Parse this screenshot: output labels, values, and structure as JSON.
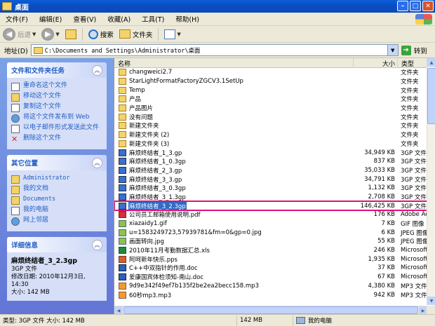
{
  "window": {
    "title": "桌面"
  },
  "menu": [
    "文件(F)",
    "编辑(E)",
    "查看(V)",
    "收藏(A)",
    "工具(T)",
    "帮助(H)"
  ],
  "toolbar": {
    "back": "后退",
    "search": "搜索",
    "folders": "文件夹"
  },
  "address": {
    "label": "地址(D)",
    "path": "C:\\Documents and Settings\\Administrator\\桌面",
    "go": "转到"
  },
  "tasks": {
    "title": "文件和文件夹任务",
    "items": [
      "重命名这个文件",
      "移动这个文件",
      "复制这个文件",
      "将这个文件发布到 Web",
      "以电子邮件形式发送此文件",
      "删除这个文件"
    ]
  },
  "places": {
    "title": "其它位置",
    "items": [
      "Administrator",
      "我的文档",
      "Documents",
      "我的电脑",
      "网上邻居"
    ]
  },
  "details": {
    "title": "详细信息",
    "name": "麻烦终结者_3_2.3gp",
    "type": "3GP 文件",
    "modified_label": "修改日期: 2010年12月3日, 14:30",
    "size": "大小: 142 MB"
  },
  "columns": {
    "name": "名称",
    "size": "大小",
    "type": "类型"
  },
  "files": [
    {
      "name": "changweici2.7",
      "size": "",
      "type": "文件夹",
      "icon": "folder"
    },
    {
      "name": "StarLightFormatFactoryZGCV3.1SetUp",
      "size": "",
      "type": "文件夹",
      "icon": "folder"
    },
    {
      "name": "Temp",
      "size": "",
      "type": "文件夹",
      "icon": "folder"
    },
    {
      "name": "产品",
      "size": "",
      "type": "文件夹",
      "icon": "folder"
    },
    {
      "name": "产品图片",
      "size": "",
      "type": "文件夹",
      "icon": "folder"
    },
    {
      "name": "没有问题",
      "size": "",
      "type": "文件夹",
      "icon": "folder"
    },
    {
      "name": "新建文件夹",
      "size": "",
      "type": "文件夹",
      "icon": "folder"
    },
    {
      "name": "新建文件夹 (2)",
      "size": "",
      "type": "文件夹",
      "icon": "folder"
    },
    {
      "name": "新建文件夹 (3)",
      "size": "",
      "type": "文件夹",
      "icon": "folder"
    },
    {
      "name": "麻烦终结者_1_3.gp",
      "size": "34,949 KB",
      "type": "3GP 文件",
      "icon": "gp"
    },
    {
      "name": "麻烦终结者_1_0.3gp",
      "size": "837 KB",
      "type": "3GP 文件",
      "icon": "gp"
    },
    {
      "name": "麻烦终结者_2_3.gp",
      "size": "35,033 KB",
      "type": "3GP 文件",
      "icon": "gp"
    },
    {
      "name": "麻烦终结者_3_3.gp",
      "size": "34,791 KB",
      "type": "3GP 文件",
      "icon": "gp"
    },
    {
      "name": "麻烦终结者_3_0.3gp",
      "size": "1,132 KB",
      "type": "3GP 文件",
      "icon": "gp"
    },
    {
      "name": "麻烦终结者_3_1.3gp",
      "size": "2,708 KB",
      "type": "3GP 文件",
      "icon": "gp"
    },
    {
      "name": "麻烦终结者_3_2.3gp",
      "size": "146,425 KB",
      "type": "3GP 文件",
      "icon": "gp",
      "selected": true
    },
    {
      "name": "公司员工邮箱使用说明.pdf",
      "size": "176 KB",
      "type": "Adobe Acr",
      "icon": "pdf"
    },
    {
      "name": "xiazaidy1.gif",
      "size": "7 KB",
      "type": "GIF 图像",
      "icon": "img"
    },
    {
      "name": "u=1583249723,57939781&fm=0&gp=0.jpg",
      "size": "6 KB",
      "type": "JPEG 图像",
      "icon": "img"
    },
    {
      "name": "画面转向.jpg",
      "size": "55 KB",
      "type": "JPEG 图像",
      "icon": "img"
    },
    {
      "name": "2010年11月考勤数据汇总.xls",
      "size": "246 KB",
      "type": "Microsoft",
      "icon": "xls"
    },
    {
      "name": "阿呵新年快乐.pps",
      "size": "1,935 KB",
      "type": "Microsoft",
      "icon": "pps"
    },
    {
      "name": "C++中双指针的作用.doc",
      "size": "37 KB",
      "type": "Microsoft",
      "icon": "doc"
    },
    {
      "name": "爱康国宾体检须知-南山.doc",
      "size": "67 KB",
      "type": "Microsoft",
      "icon": "doc"
    },
    {
      "name": "9d9e342f49ef7b135f2be2ea2becc158.mp3",
      "size": "4,380 KB",
      "type": "MP3 文件",
      "icon": "mp3"
    },
    {
      "name": "60秒mp3.mp3",
      "size": "942 KB",
      "type": "MP3 文件",
      "icon": "mp3"
    }
  ],
  "status": {
    "left": "类型: 3GP 文件 大小: 142 MB",
    "middle": "142 MB",
    "right": "我的电脑"
  }
}
